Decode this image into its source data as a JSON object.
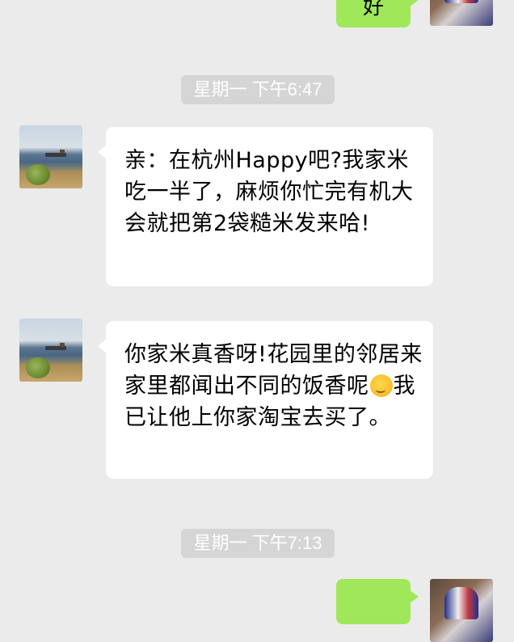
{
  "chat": {
    "messages": [
      {
        "side": "right",
        "text": "好"
      },
      {
        "type": "time",
        "text": "星期一 下午6:47"
      },
      {
        "side": "left",
        "text_before": "亲：在杭州Happy吧?我家米吃一半了，麻烦你忙完有机大会就把第2袋糙米发来哈!"
      },
      {
        "side": "left",
        "text_before": "你家米真香呀!花园里的邻居来家里都闻出不同的饭香呢",
        "emoji": "embarrassed-smile-emoji",
        "text_after": "我已让他上你家淘宝去买了。"
      },
      {
        "type": "time",
        "text": "星期一 下午7:13"
      },
      {
        "side": "right",
        "text": ""
      }
    ]
  },
  "colors": {
    "background": "#ebebeb",
    "sent_bubble": "#a0e75a",
    "received_bubble": "#ffffff",
    "time_pill": "#d5d5d5"
  }
}
